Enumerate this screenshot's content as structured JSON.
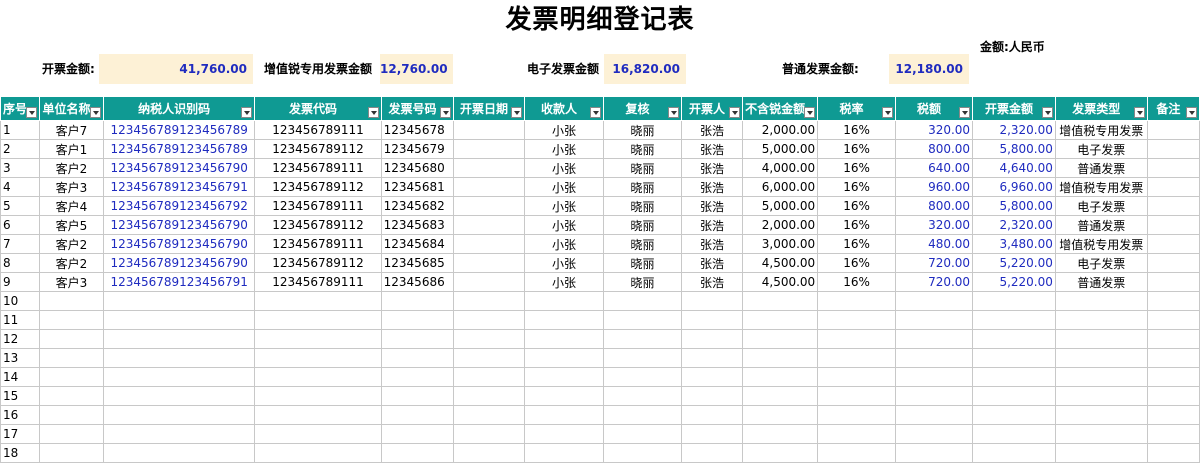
{
  "title": "发票明细登记表",
  "unit": "金额:人民币",
  "summary": {
    "total_label": "开票金额:",
    "total_value": "41,760.00",
    "vat_label": "增值锐专用发票金额",
    "vat_value": "12,760.00",
    "e_label": "电子发票金额",
    "e_value": "16,820.00",
    "normal_label": "普通发票金额:",
    "normal_value": "12,180.00"
  },
  "columns": [
    "序号",
    "单位名称",
    "纳税人识别码",
    "发票代码",
    "发票号码",
    "开票日期",
    "收款人",
    "复核",
    "开票人",
    "不含锐金额",
    "税率",
    "税额",
    "开票金额",
    "发票类型",
    "备注"
  ],
  "rows": [
    {
      "no": "1",
      "client": "客户7",
      "taxid": "123456789123456789",
      "code": "123456789111",
      "number": "12345678",
      "date": "",
      "payee": "小张",
      "review": "晓丽",
      "issuer": "张浩",
      "net": "2,000.00",
      "rate": "16%",
      "tax": "320.00",
      "amount": "2,320.00",
      "type": "增值税专用发票",
      "note": ""
    },
    {
      "no": "2",
      "client": "客户1",
      "taxid": "123456789123456789",
      "code": "123456789112",
      "number": "12345679",
      "date": "",
      "payee": "小张",
      "review": "晓丽",
      "issuer": "张浩",
      "net": "5,000.00",
      "rate": "16%",
      "tax": "800.00",
      "amount": "5,800.00",
      "type": "电子发票",
      "note": ""
    },
    {
      "no": "3",
      "client": "客户2",
      "taxid": "123456789123456790",
      "code": "123456789111",
      "number": "12345680",
      "date": "",
      "payee": "小张",
      "review": "晓丽",
      "issuer": "张浩",
      "net": "4,000.00",
      "rate": "16%",
      "tax": "640.00",
      "amount": "4,640.00",
      "type": "普通发票",
      "note": ""
    },
    {
      "no": "4",
      "client": "客户3",
      "taxid": "123456789123456791",
      "code": "123456789112",
      "number": "12345681",
      "date": "",
      "payee": "小张",
      "review": "晓丽",
      "issuer": "张浩",
      "net": "6,000.00",
      "rate": "16%",
      "tax": "960.00",
      "amount": "6,960.00",
      "type": "增值税专用发票",
      "note": ""
    },
    {
      "no": "5",
      "client": "客户4",
      "taxid": "123456789123456792",
      "code": "123456789111",
      "number": "12345682",
      "date": "",
      "payee": "小张",
      "review": "晓丽",
      "issuer": "张浩",
      "net": "5,000.00",
      "rate": "16%",
      "tax": "800.00",
      "amount": "5,800.00",
      "type": "电子发票",
      "note": ""
    },
    {
      "no": "6",
      "client": "客户5",
      "taxid": "123456789123456790",
      "code": "123456789112",
      "number": "12345683",
      "date": "",
      "payee": "小张",
      "review": "晓丽",
      "issuer": "张浩",
      "net": "2,000.00",
      "rate": "16%",
      "tax": "320.00",
      "amount": "2,320.00",
      "type": "普通发票",
      "note": ""
    },
    {
      "no": "7",
      "client": "客户2",
      "taxid": "123456789123456790",
      "code": "123456789111",
      "number": "12345684",
      "date": "",
      "payee": "小张",
      "review": "晓丽",
      "issuer": "张浩",
      "net": "3,000.00",
      "rate": "16%",
      "tax": "480.00",
      "amount": "3,480.00",
      "type": "增值税专用发票",
      "note": ""
    },
    {
      "no": "8",
      "client": "客户2",
      "taxid": "123456789123456790",
      "code": "123456789112",
      "number": "12345685",
      "date": "",
      "payee": "小张",
      "review": "晓丽",
      "issuer": "张浩",
      "net": "4,500.00",
      "rate": "16%",
      "tax": "720.00",
      "amount": "5,220.00",
      "type": "电子发票",
      "note": ""
    },
    {
      "no": "9",
      "client": "客户3",
      "taxid": "123456789123456791",
      "code": "123456789111",
      "number": "12345686",
      "date": "",
      "payee": "小张",
      "review": "晓丽",
      "issuer": "张浩",
      "net": "4,500.00",
      "rate": "16%",
      "tax": "720.00",
      "amount": "5,220.00",
      "type": "普通发票",
      "note": ""
    }
  ],
  "empty_rows": [
    "10",
    "11",
    "12",
    "13",
    "14",
    "15",
    "16",
    "17",
    "18"
  ],
  "colors": {
    "header_bg": "#0f9a93",
    "summary_bg": "#fdf1d6",
    "value_blue": "#1f2bbf"
  }
}
